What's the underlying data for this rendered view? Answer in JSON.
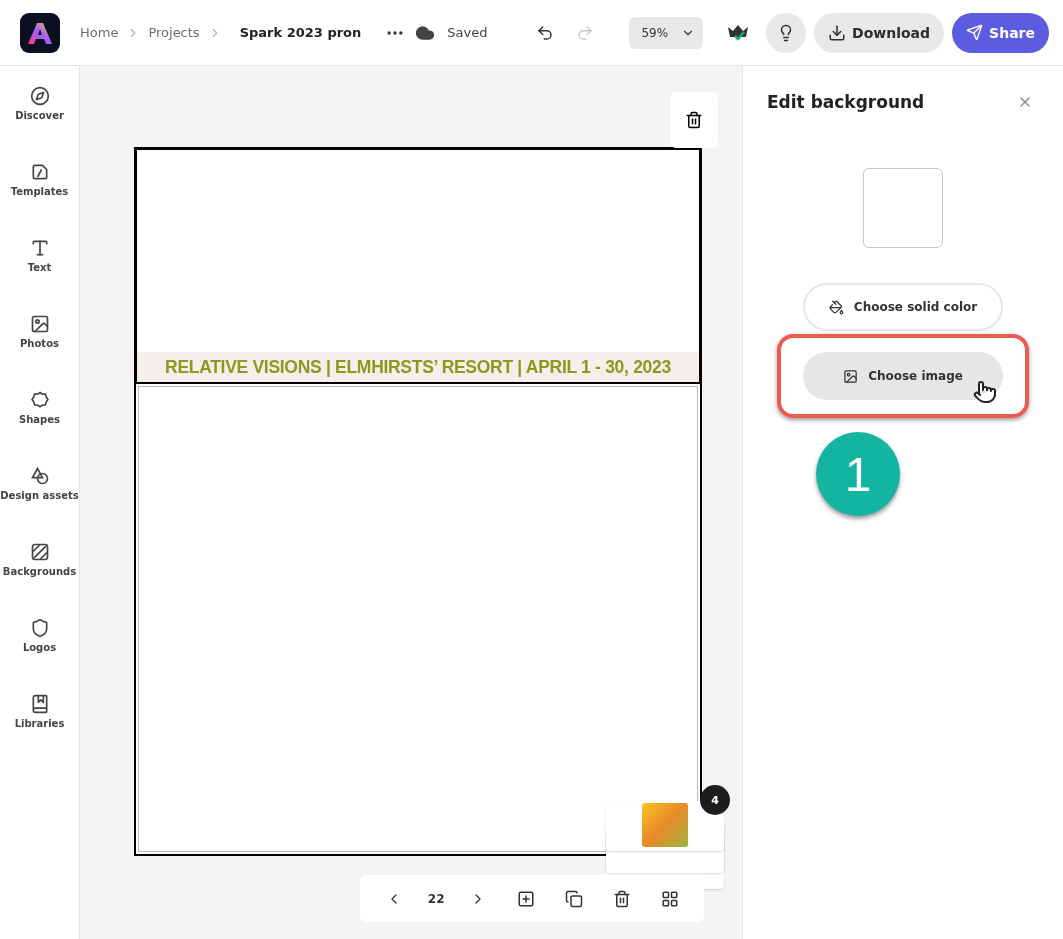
{
  "header": {
    "breadcrumbs": [
      "Home",
      "Projects"
    ],
    "document_title": "Spark 2023 pron",
    "save_status": "Saved",
    "zoom": "59%",
    "download": "Download",
    "share": "Share"
  },
  "sidebar": {
    "items": [
      {
        "label": "Discover"
      },
      {
        "label": "Templates"
      },
      {
        "label": "Text"
      },
      {
        "label": "Photos"
      },
      {
        "label": "Shapes"
      },
      {
        "label": "Design assets"
      },
      {
        "label": "Backgrounds"
      },
      {
        "label": "Logos"
      },
      {
        "label": "Libraries"
      }
    ]
  },
  "canvas": {
    "banner": "RELATIVE VISIONS | ELMHIRSTS’ RESORT | APRIL 1 - 30, 2023",
    "page_number": "22",
    "page_count_badge": "4"
  },
  "panel": {
    "title": "Edit background",
    "buttons": [
      {
        "label": "Choose solid color",
        "kind": "outline",
        "highlighted": false
      },
      {
        "label": "Choose image",
        "kind": "filled",
        "highlighted": true
      }
    ],
    "step_badge": "1"
  }
}
